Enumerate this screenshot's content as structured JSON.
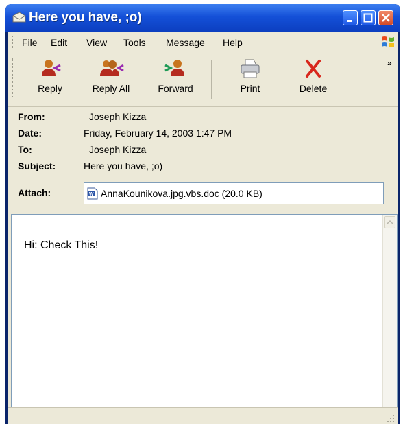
{
  "window": {
    "title": "Here you have, ;o)"
  },
  "menu": {
    "items": [
      {
        "label": "File",
        "mnemonic": "F",
        "rest": "ile"
      },
      {
        "label": "Edit",
        "mnemonic": "E",
        "rest": "dit"
      },
      {
        "label": "View",
        "mnemonic": "V",
        "rest": "iew"
      },
      {
        "label": "Tools",
        "mnemonic": "T",
        "rest": "ools"
      },
      {
        "label": "Message",
        "mnemonic": "M",
        "rest": "essage"
      },
      {
        "label": "Help",
        "mnemonic": "H",
        "rest": "elp"
      }
    ]
  },
  "toolbar": {
    "reply": "Reply",
    "reply_all": "Reply All",
    "forward": "Forward",
    "print": "Print",
    "delete": "Delete",
    "overflow": "»"
  },
  "headers": {
    "from_label": "From:",
    "from_value": "Joseph Kizza",
    "date_label": "Date:",
    "date_value": "Friday, February 14, 2003 1:47 PM",
    "to_label": "To:",
    "to_value": "Joseph Kizza",
    "subject_label": "Subject:",
    "subject_value": "Here you have, ;o)",
    "attach_label": "Attach:",
    "attach_value": "AnnaKounikova.jpg.vbs.doc (20.0 KB)"
  },
  "message": {
    "body": "Hi: Check This!"
  },
  "colors": {
    "titlebar": "#1450d8",
    "face": "#ece9d8",
    "close": "#d24b2a",
    "delete_x": "#d8271c"
  }
}
